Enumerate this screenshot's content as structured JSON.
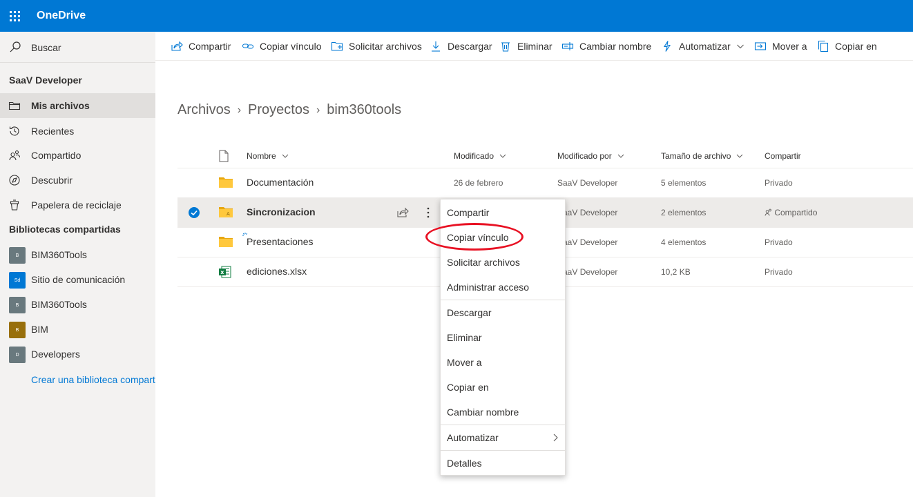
{
  "app": {
    "title": "OneDrive"
  },
  "search": {
    "label": "Buscar"
  },
  "sidebar": {
    "user_name": "SaaV Developer",
    "items": [
      {
        "label": "Mis archivos",
        "icon": "folder-icon",
        "selected": true
      },
      {
        "label": "Recientes",
        "icon": "history-icon",
        "selected": false
      },
      {
        "label": "Compartido",
        "icon": "people-icon",
        "selected": false
      },
      {
        "label": "Descubrir",
        "icon": "compass-icon",
        "selected": false
      },
      {
        "label": "Papelera de reciclaje",
        "icon": "recycle-bin-icon",
        "selected": false
      }
    ],
    "libraries_title": "Bibliotecas compartidas",
    "libraries": [
      {
        "label": "BIM360Tools",
        "badge": "B",
        "color": "#69797e"
      },
      {
        "label": "Sitio de comunicación",
        "badge": "Sd",
        "color": "#0078d4"
      },
      {
        "label": "BIM360Tools",
        "badge": "B",
        "color": "#69797e"
      },
      {
        "label": "BIM",
        "badge": "B",
        "color": "#986f0b"
      },
      {
        "label": "Developers",
        "badge": "D",
        "color": "#69797e"
      }
    ],
    "create_library": "Crear una biblioteca compartida"
  },
  "toolbar": {
    "share": "Compartir",
    "copy_link": "Copiar vínculo",
    "request_files": "Solicitar archivos",
    "download": "Descargar",
    "delete": "Eliminar",
    "rename": "Cambiar nombre",
    "automate": "Automatizar",
    "move_to": "Mover a",
    "copy_to": "Copiar en"
  },
  "breadcrumb": [
    "Archivos",
    "Proyectos",
    "bim360tools"
  ],
  "list": {
    "columns": {
      "name": "Nombre",
      "modified": "Modificado",
      "modified_by": "Modificado por",
      "size": "Tamaño de archivo",
      "sharing": "Compartir"
    },
    "rows": [
      {
        "name": "Documentación",
        "type": "folder",
        "modified": "26 de febrero",
        "modified_by": "SaaV Developer",
        "size": "5 elementos",
        "sharing": "Privado",
        "selected": false
      },
      {
        "name": "Sincronizacion",
        "type": "folder-shared",
        "modified": "",
        "modified_by": "SaaV Developer",
        "size": "2 elementos",
        "sharing": "Compartido",
        "selected": true
      },
      {
        "name": "Presentaciones",
        "type": "folder",
        "modified": "",
        "modified_by": "SaaV Developer",
        "size": "4 elementos",
        "sharing": "Privado",
        "selected": false
      },
      {
        "name": "ediciones.xlsx",
        "type": "excel",
        "modified": "",
        "modified_by": "SaaV Developer",
        "size": "10,2 KB",
        "sharing": "Privado",
        "selected": false
      }
    ]
  },
  "context_menu": {
    "items": [
      "Compartir",
      "Copiar vínculo",
      "Solicitar archivos",
      "Administrar acceso",
      "Descargar",
      "Eliminar",
      "Mover a",
      "Copiar en",
      "Cambiar nombre",
      "Automatizar",
      "Detalles"
    ]
  },
  "colors": {
    "brand": "#0078d4",
    "folder": "#ffb900",
    "excel": "#107c41",
    "annotation": "#e81123"
  }
}
